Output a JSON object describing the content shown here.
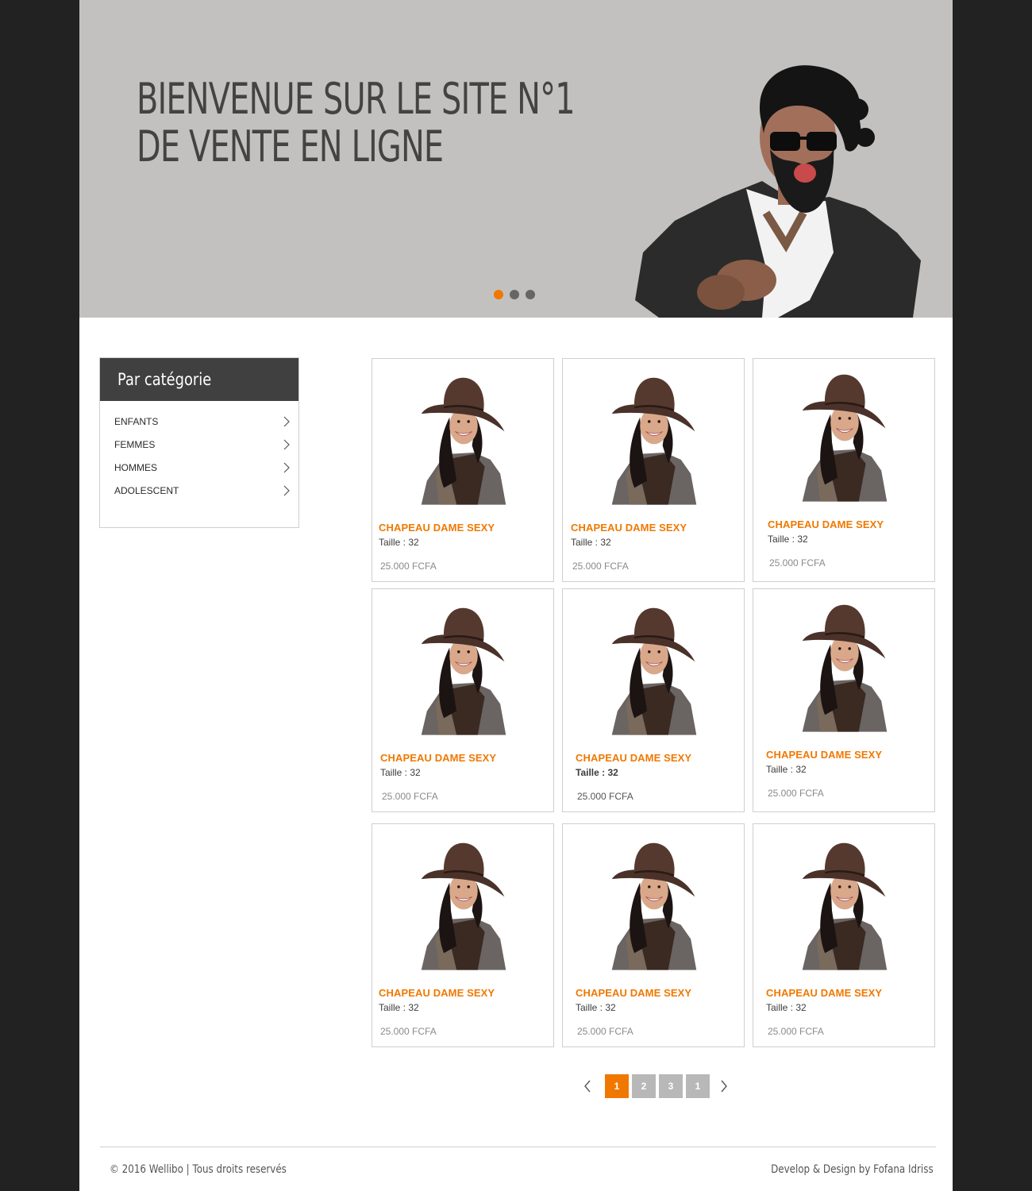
{
  "hero": {
    "title_line1": "BIENVENUE SUR LE SITE N°1",
    "title_line2": "DE VENTE EN LIGNE",
    "slides": 3,
    "active_slide": 1
  },
  "sidebar": {
    "title": "Par catégorie",
    "items": [
      {
        "label": "ENFANTS",
        "icon": "chevron-right-icon"
      },
      {
        "label": "FEMMES",
        "icon": "chevron-right-icon"
      },
      {
        "label": "HOMMES",
        "icon": "chevron-right-icon"
      },
      {
        "label": "ADOLESCENT",
        "icon": "chevron-right-icon"
      }
    ]
  },
  "products": [
    {
      "name": "CHAPEAU DAME SEXY",
      "size": "Taille : 32",
      "price": "25.000 FCFA"
    },
    {
      "name": "CHAPEAU DAME SEXY",
      "size": "Taille : 32",
      "price": "25.000 FCFA"
    },
    {
      "name": "CHAPEAU DAME SEXY",
      "size": "Taille : 32",
      "price": "25.000 FCFA"
    },
    {
      "name": "CHAPEAU DAME SEXY",
      "size": "Taille : 32",
      "price": "25.000 FCFA"
    },
    {
      "name": "CHAPEAU DAME SEXY",
      "size": "Taille : 32",
      "price": "25.000 FCFA"
    },
    {
      "name": "CHAPEAU DAME SEXY",
      "size": "Taille : 32",
      "price": "25.000 FCFA"
    },
    {
      "name": "CHAPEAU DAME SEXY",
      "size": "Taille : 32",
      "price": "25.000 FCFA"
    },
    {
      "name": "CHAPEAU DAME SEXY",
      "size": "Taille : 32",
      "price": "25.000 FCFA"
    },
    {
      "name": "CHAPEAU DAME SEXY",
      "size": "Taille : 32",
      "price": "25.000 FCFA"
    }
  ],
  "pagination": {
    "pages": [
      "1",
      "2",
      "3",
      "1"
    ],
    "active_index": 0
  },
  "footer": {
    "copyright": "© 2016 Wellibo | Tous droits reservés",
    "credit": "Develop & Design by Fofana Idriss"
  },
  "colors": {
    "accent": "#f07800",
    "page_bg": "#222222",
    "hero_bg": "#c2c1bf",
    "sidebar_head": "#404040"
  }
}
